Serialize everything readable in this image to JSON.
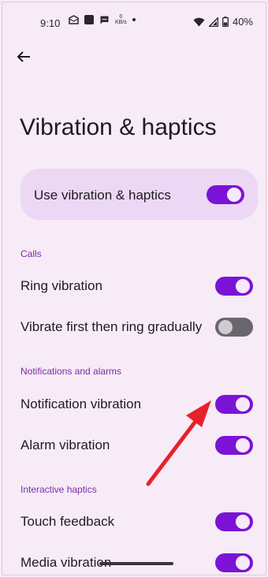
{
  "status_bar": {
    "time": "9:10",
    "net_speed_top": "0",
    "net_speed_unit": "KB/s",
    "battery_percent": "40%",
    "icons": [
      "mail-icon",
      "square-app-icon",
      "chat-icon",
      "wifi-icon",
      "signal-icon",
      "battery-icon"
    ]
  },
  "page": {
    "title": "Vibration & haptics",
    "master_toggle": {
      "label": "Use vibration & haptics",
      "on": true
    }
  },
  "sections": [
    {
      "header": "Calls",
      "items": [
        {
          "label": "Ring vibration",
          "on": true
        },
        {
          "label": "Vibrate first then ring gradually",
          "on": false
        }
      ]
    },
    {
      "header": "Notifications and alarms",
      "items": [
        {
          "label": "Notification vibration",
          "on": true
        },
        {
          "label": "Alarm vibration",
          "on": true
        }
      ]
    },
    {
      "header": "Interactive haptics",
      "items": [
        {
          "label": "Touch feedback",
          "on": true
        },
        {
          "label": "Media vibration",
          "on": true
        }
      ]
    }
  ],
  "colors": {
    "background": "#f7ebf7",
    "accent": "#7b13d6",
    "section_header": "#7a2ea5",
    "annotation_arrow": "#e8202a"
  }
}
